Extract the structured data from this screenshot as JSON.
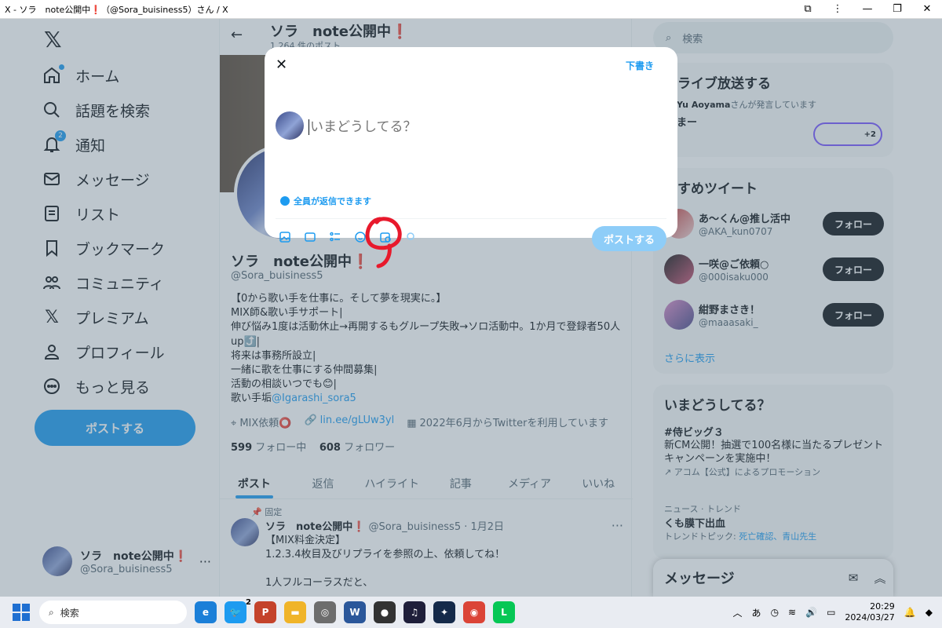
{
  "window": {
    "title": "X - ソラ　note公開中❗（@Sora_buisiness5）さん / X"
  },
  "nav": {
    "logo": "𝕏",
    "items": [
      {
        "label": "ホーム"
      },
      {
        "label": "話題を検索"
      },
      {
        "label": "通知",
        "badge": "2"
      },
      {
        "label": "メッセージ"
      },
      {
        "label": "リスト"
      },
      {
        "label": "ブックマーク"
      },
      {
        "label": "コミュニティ"
      },
      {
        "label": "プレミアム"
      },
      {
        "label": "プロフィール"
      },
      {
        "label": "もっと見る"
      }
    ],
    "post_button": "ポストする",
    "account": {
      "name": "ソラ　note公開中❗",
      "handle": "@Sora_buisiness5"
    }
  },
  "profile": {
    "header_name": "ソラ　note公開中❗",
    "post_count": "1,264 件のポスト",
    "name": "ソラ　note公開中❗",
    "handle": "@Sora_buisiness5",
    "bio": "【0から歌い手を仕事に。そして夢を現実に。】\nMIX師&歌い手サポート|\n伸び悩み1度は活動休止→再開するもグループ失敗→ソロ活動中。1か月で登録者50人up⤴️|\n将来は事務所設立|\n一緒に歌を仕事にする仲間募集|\n活動の相談いつでも😊|\n歌い手垢",
    "bio_link": "@Igarashi_sora5",
    "meta_location": "MIX依頼⭕",
    "meta_link": "lin.ee/gLUw3yl",
    "meta_joined": "2022年6月からTwitterを利用しています",
    "following_count": "599",
    "following_label": "フォロー中",
    "followers_count": "608",
    "followers_label": "フォロワー",
    "tabs": [
      "ポスト",
      "返信",
      "ハイライト",
      "記事",
      "メディア",
      "いいね"
    ],
    "pinned_label": "固定",
    "tweet": {
      "name": "ソラ　note公開中❗",
      "handle": "@Sora_buisiness5 · 1月2日",
      "body": "【MIX料金決定】\n1.2.3.4枚目及びリプライを参照の上、依頼してね！\n\n1人フルコーラスだと、"
    }
  },
  "right": {
    "search_placeholder": "検索",
    "live": {
      "title": "でライブ放送する",
      "speaker": "Yu Aoyama",
      "speaker_suffix": "さんが発言しています",
      "room": "まー",
      "extra": "+2"
    },
    "reco": {
      "title": "すすめツイート",
      "users": [
        {
          "name": "あ〜くん@推し活中",
          "handle": "@AKA_kun0707",
          "button": "フォロー"
        },
        {
          "name": "一咲@ご依頼○",
          "handle": "@000isaku000",
          "button": "フォロー"
        },
        {
          "name": "紺野まさき！",
          "handle": "@maaasaki_",
          "button": "フォロー"
        }
      ],
      "more": "さらに表示"
    },
    "trends": {
      "title": "いまどうしてる？",
      "items": [
        {
          "title": "#侍ビッグ３",
          "desc": "新CM公開！抽選で100名様に当たるプレゼントキャンペーンを実施中！",
          "meta": "アコム【公式】によるプロモーション"
        },
        {
          "category": "ニュース · トレンド",
          "title": "くも膜下出血",
          "meta_prefix": "トレンドトピック: ",
          "meta_links": "死亡確認、青山先生"
        }
      ]
    },
    "messages": "メッセージ"
  },
  "modal": {
    "drafts": "下書き",
    "placeholder": "いまどうしてる？",
    "reply_setting": "全員が返信できます",
    "post_button": "ポストする"
  },
  "taskbar": {
    "search": "検索",
    "twitter_badge": "2",
    "ime": "あ",
    "time": "20:29",
    "date": "2024/03/27"
  },
  "colors": {
    "accent": "#1d9bf0",
    "annotation": "#e8192c"
  }
}
